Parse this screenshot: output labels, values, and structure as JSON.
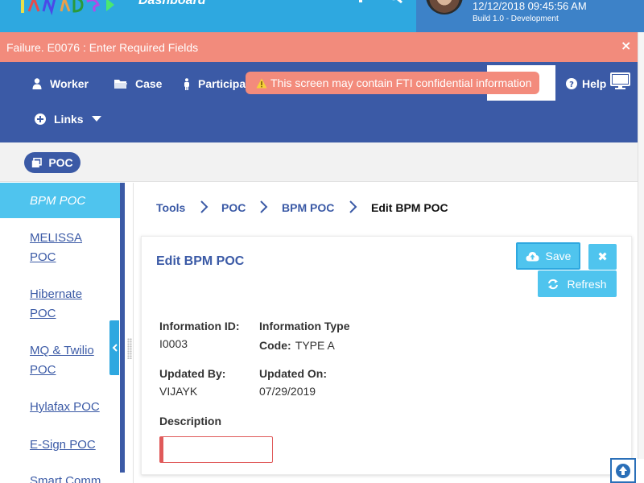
{
  "header": {
    "app_title": "Dashboard",
    "datetime": "12/12/2018 09:45:56 AM",
    "build": "Build 1.0 - Development",
    "icons": [
      "grid-icon",
      "monitor-icon",
      "search-icon"
    ]
  },
  "alert": {
    "message": "Failure. E0076 : Enter Required Fields",
    "close": "×"
  },
  "nav": {
    "items": [
      {
        "label": "Worker",
        "icon": "user-icon"
      },
      {
        "label": "Case",
        "icon": "folder-icon"
      },
      {
        "label": "Participa",
        "icon": "person-icon"
      },
      {
        "label": "Help",
        "icon": "question-circle-icon"
      },
      {
        "label": "Links",
        "icon": "plus-circle-icon"
      }
    ],
    "fti_warning": "This screen may contain FTI confidential information"
  },
  "tags": {
    "active": "POC"
  },
  "sidebar": {
    "active": "BPM POC",
    "items": [
      {
        "label": "MELISSA POC"
      },
      {
        "label": "Hibernate POC"
      },
      {
        "label": "MQ & Twilio POC"
      },
      {
        "label": "Hylafax POC"
      },
      {
        "label": "E-Sign POC"
      },
      {
        "label": "Smart Comm"
      }
    ]
  },
  "breadcrumb": {
    "items": [
      "Tools",
      "POC",
      "BPM POC"
    ],
    "current": "Edit BPM POC"
  },
  "form": {
    "title": "Edit BPM POC",
    "save_label": "Save",
    "close_label": "✖",
    "refresh_label": "Refresh",
    "information_id_label": "Information ID:",
    "information_id": "I0003",
    "information_type_label": "Information Type",
    "code_label": "Code:",
    "code_value": "TYPE A",
    "updated_by_label": "Updated By:",
    "updated_by": "VIJAYK",
    "updated_on_label": "Updated On:",
    "updated_on": "07/29/2019",
    "description_label": "Description",
    "description_value": ""
  },
  "colors": {
    "header_blue": "#2ea8e0",
    "nav_blue": "#3b5aa6",
    "error_banner": "#f28b7c",
    "accent_cyan": "#4fc4ee",
    "invalid_red": "#e05a5a"
  }
}
